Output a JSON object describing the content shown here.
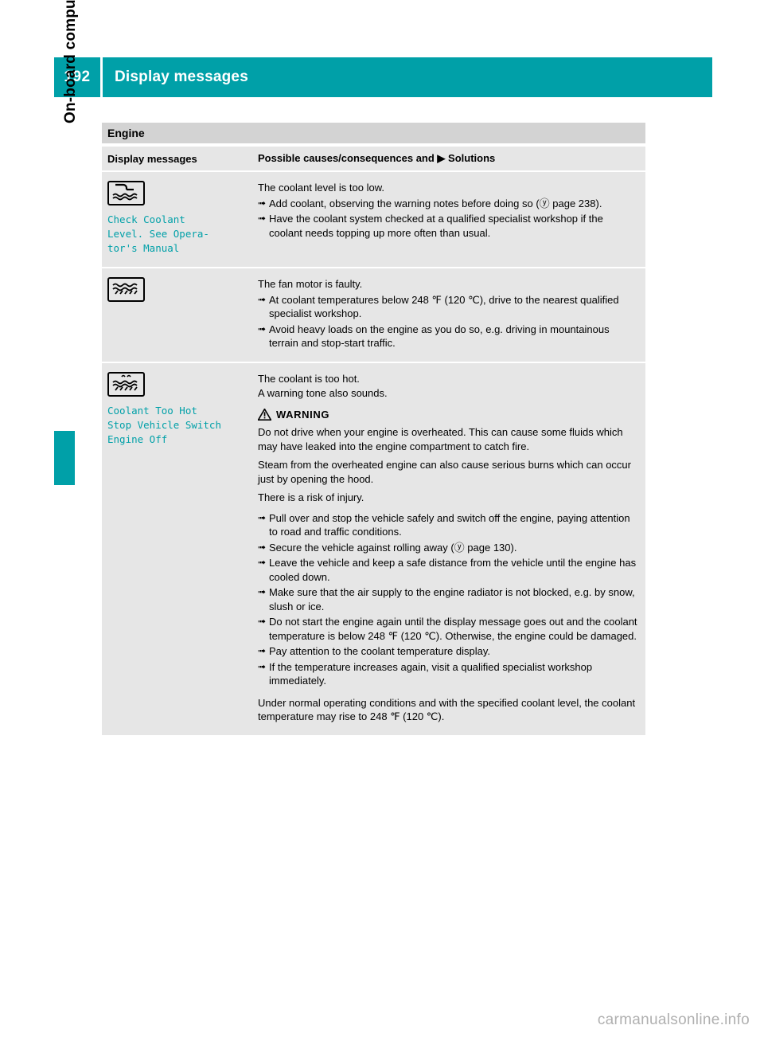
{
  "header": {
    "page_number": "192",
    "title": "Display messages"
  },
  "side_tab": {
    "label": "On-board computer and displays"
  },
  "table": {
    "section_title": "Engine",
    "columns": {
      "left": "Display messages",
      "right": "Possible causes/consequences and ▶ Solutions"
    },
    "rows": [
      {
        "icon": "coolant-level-icon",
        "message": "Check Coolant\nLevel. See Opera‑\ntor's Manual",
        "content": [
          {
            "type": "para",
            "text": "The coolant level is too low."
          },
          {
            "type": "bullet",
            "text": "Add coolant, observing the warning notes before doing so (ⓨ page 238)."
          },
          {
            "type": "bullet",
            "text": "Have the coolant system checked at a qualified specialist workshop if the coolant needs topping up more often than usual."
          }
        ]
      },
      {
        "icon": "fan-motor-icon",
        "message": "",
        "content": [
          {
            "type": "para",
            "text": "The fan motor is faulty."
          },
          {
            "type": "bullet",
            "text": "At coolant temperatures below 248 ℉ (120 ℃), drive to the nearest qualified specialist workshop."
          },
          {
            "type": "bullet",
            "text": "Avoid heavy loads on the engine as you do so, e.g. driving in mountainous terrain and stop-start traffic."
          }
        ]
      },
      {
        "icon": "coolant-hot-icon",
        "message": "Coolant Too Hot\nStop Vehicle Switch\nEngine Off",
        "content": [
          {
            "type": "para",
            "text": "The coolant is too hot."
          },
          {
            "type": "para",
            "text": "A warning tone also sounds."
          },
          {
            "type": "warning",
            "text": "WARNING"
          },
          {
            "type": "para",
            "text": "Do not drive when your engine is overheated. This can cause some fluids which may have leaked into the engine compartment to catch fire."
          },
          {
            "type": "para",
            "text": "Steam from the overheated engine can also cause serious burns which can occur just by opening the hood."
          },
          {
            "type": "para",
            "text": "There is a risk of injury."
          },
          {
            "type": "bullet",
            "text": "Pull over and stop the vehicle safely and switch off the engine, paying attention to road and traffic conditions."
          },
          {
            "type": "bullet",
            "text": "Secure the vehicle against rolling away (ⓨ page 130)."
          },
          {
            "type": "bullet",
            "text": "Leave the vehicle and keep a safe distance from the vehicle until the engine has cooled down."
          },
          {
            "type": "bullet",
            "text": "Make sure that the air supply to the engine radiator is not blocked, e.g. by snow, slush or ice."
          },
          {
            "type": "bullet",
            "text": "Do not start the engine again until the display message goes out and the coolant temperature is below 248 ℉ (120 ℃). Otherwise, the engine could be damaged."
          },
          {
            "type": "bullet",
            "text": "Pay attention to the coolant temperature display."
          },
          {
            "type": "bullet",
            "text": "If the temperature increases again, visit a qualified specialist workshop immediately."
          },
          {
            "type": "para",
            "text": "Under normal operating conditions and with the specified coolant level, the coolant temperature may rise to 248 ℉ (120 ℃)."
          }
        ]
      }
    ]
  },
  "watermark": "carmanualsonline.info",
  "colors": {
    "accent": "#00a0a8",
    "table_bg": "#e6e6e6",
    "section_bg": "#d3d3d3"
  }
}
